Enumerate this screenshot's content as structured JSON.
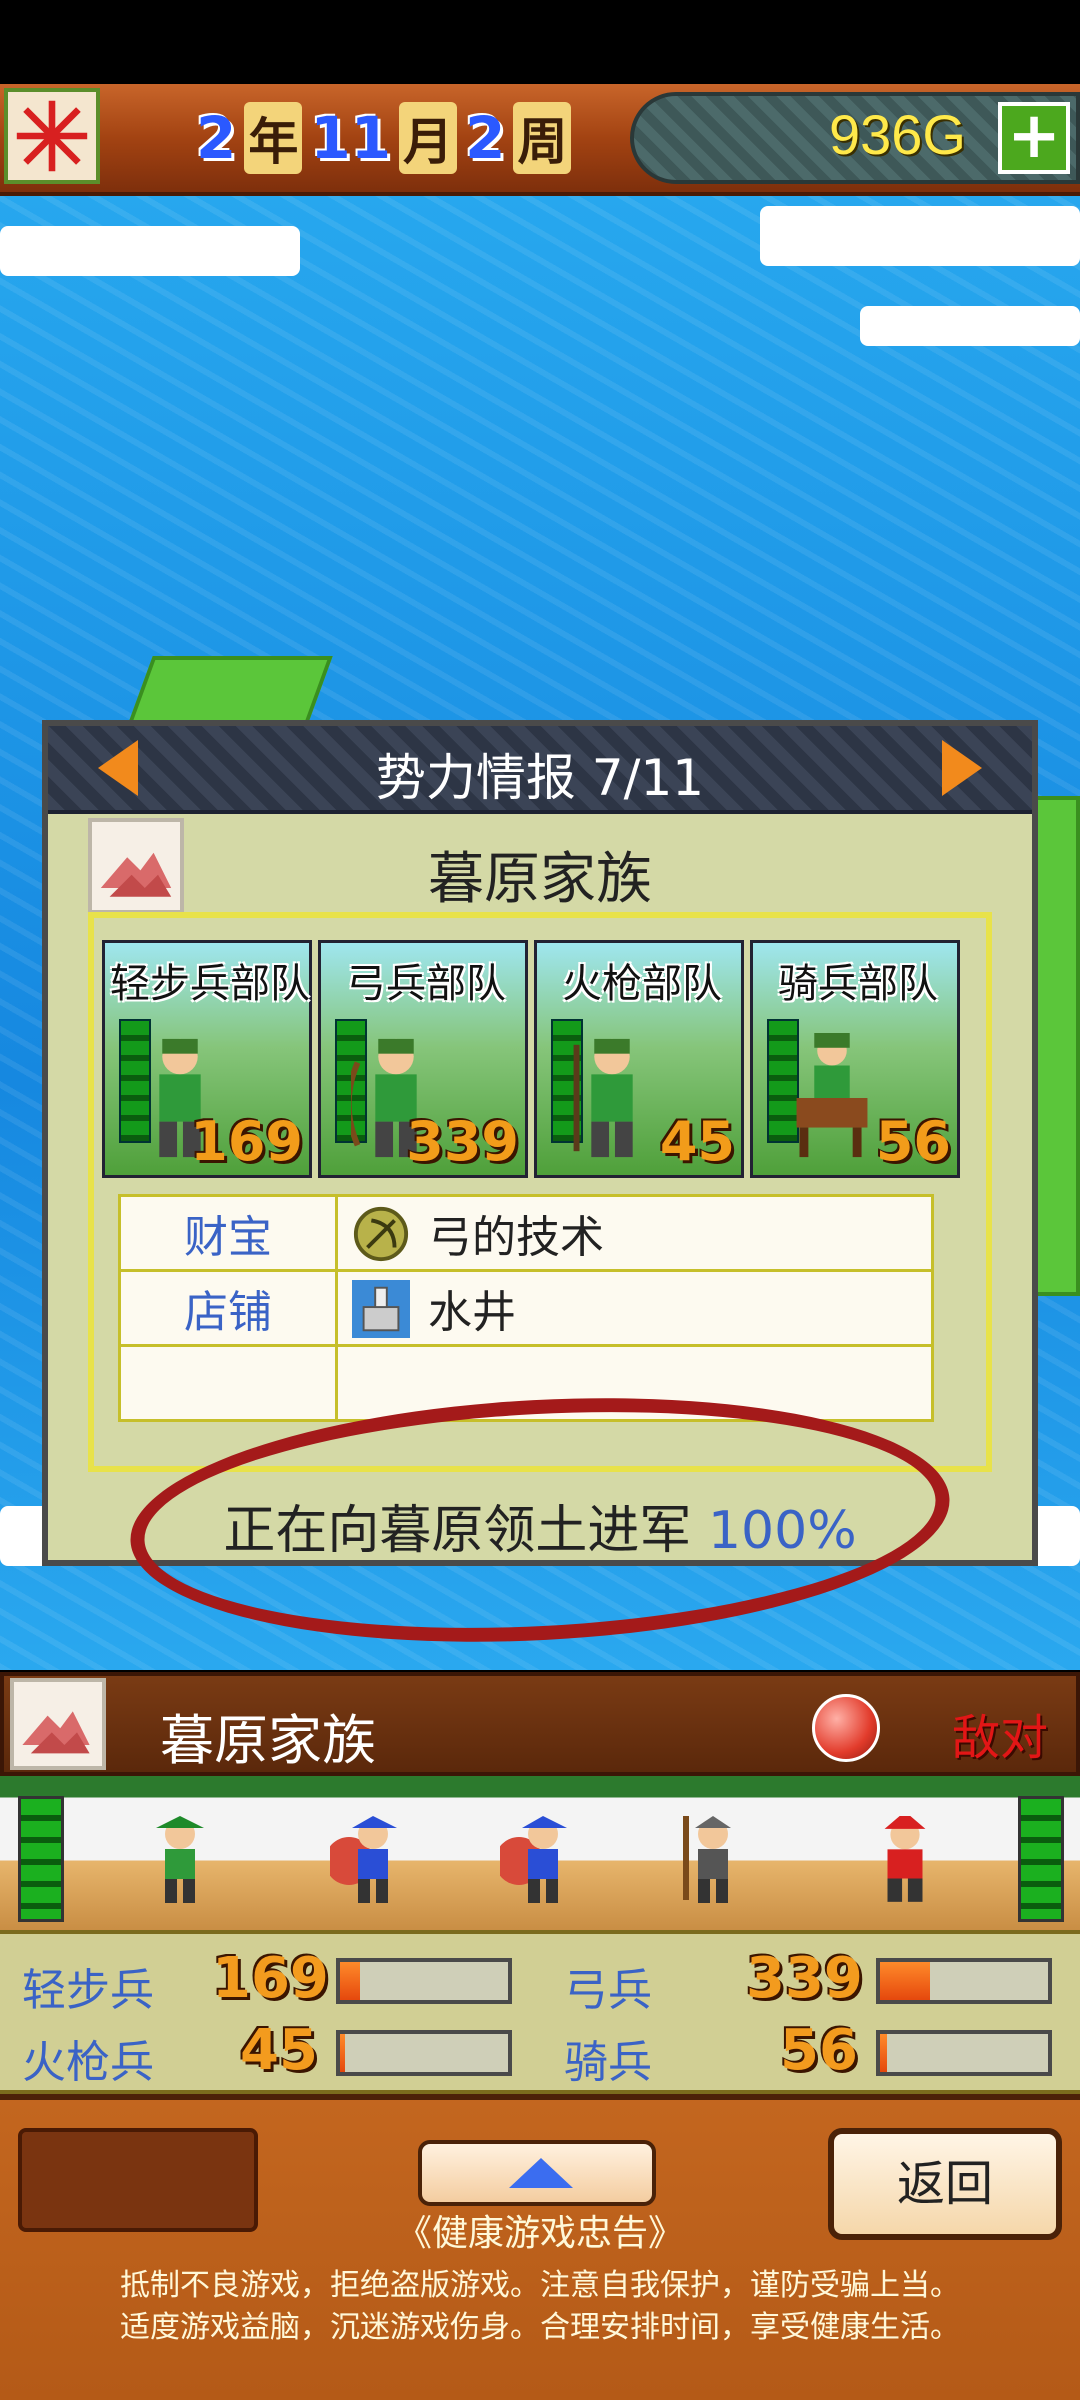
{
  "hud": {
    "year": "2",
    "year_unit": "年",
    "month": "11",
    "month_unit": "月",
    "week": "2",
    "week_unit": "周",
    "gold": "936G",
    "plus": "+"
  },
  "panel": {
    "title": "势力情报 7/11",
    "clan_name": "暮原家族",
    "units": [
      {
        "label": "轻步兵部队",
        "count": "169"
      },
      {
        "label": "弓兵部队",
        "count": "339"
      },
      {
        "label": "火枪部队",
        "count": "45"
      },
      {
        "label": "骑兵部队",
        "count": "56"
      }
    ],
    "rows": [
      {
        "key": "财宝",
        "value": "弓的技术",
        "icon": "bow-skill-icon"
      },
      {
        "key": "店铺",
        "value": "水井",
        "icon": "well-icon"
      },
      {
        "key": "",
        "value": ""
      }
    ],
    "march_text": "正在向暮原领土进军",
    "march_pct": "100%"
  },
  "battle": {
    "clan_name": "暮原家族",
    "relation": "敌对",
    "stats": [
      {
        "label": "轻步兵",
        "value": "169",
        "fill": 0.12
      },
      {
        "label": "弓兵",
        "value": "339",
        "fill": 0.3
      },
      {
        "label": "火枪兵",
        "value": "45",
        "fill": 0.03
      },
      {
        "label": "骑兵",
        "value": "56",
        "fill": 0.04
      }
    ]
  },
  "footer": {
    "back": "返回",
    "advice_title": "《健康游戏忠告》",
    "advice_line1": "抵制不良游戏，拒绝盗版游戏。注意自我保护，谨防受骗上当。",
    "advice_line2": "适度游戏益脑，沉迷游戏伤身。合理安排时间，享受健康生活。"
  },
  "colors": {
    "accent_blue": "#3a63c6",
    "enemy_red": "#e21616",
    "gold": "#ffe94a"
  }
}
